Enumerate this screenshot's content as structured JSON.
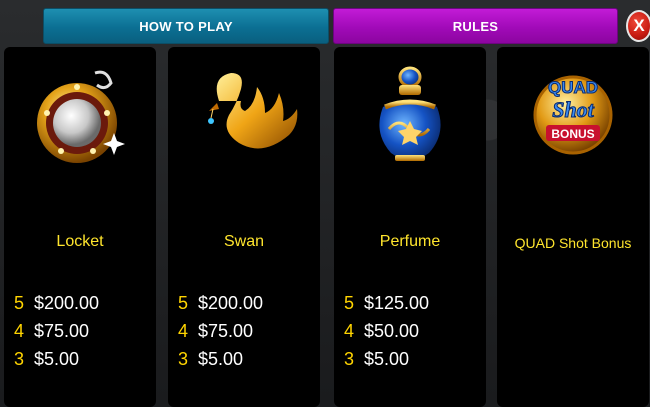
{
  "tabs": [
    {
      "label": "HOW TO PLAY",
      "color": "#0b6f93"
    },
    {
      "label": "RULES",
      "color": "#a10ab8"
    }
  ],
  "close_label": "X",
  "symbols": [
    {
      "name": "Locket",
      "icon": "locket-icon",
      "pays": [
        {
          "count": "5",
          "amount": "$200.00"
        },
        {
          "count": "4",
          "amount": "$75.00"
        },
        {
          "count": "3",
          "amount": "$5.00"
        }
      ]
    },
    {
      "name": "Swan",
      "icon": "swan-icon",
      "pays": [
        {
          "count": "5",
          "amount": "$200.00"
        },
        {
          "count": "4",
          "amount": "$75.00"
        },
        {
          "count": "3",
          "amount": "$5.00"
        }
      ]
    },
    {
      "name": "Perfume",
      "icon": "perfume-icon",
      "pays": [
        {
          "count": "5",
          "amount": "$125.00"
        },
        {
          "count": "4",
          "amount": "$50.00"
        },
        {
          "count": "3",
          "amount": "$5.00"
        }
      ]
    },
    {
      "name": "QUAD Shot Bonus",
      "icon": "quad-shot-bonus-icon",
      "badge": {
        "line1": "QUAD",
        "line2": "Shot",
        "line3": "BONUS"
      },
      "pays": []
    }
  ],
  "colors": {
    "label": "#ffe52d",
    "count": "#ffd400",
    "amount": "#ffffff"
  }
}
